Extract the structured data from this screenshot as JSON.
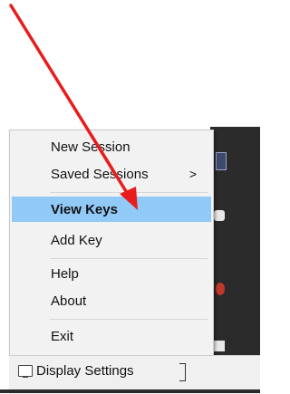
{
  "menu": {
    "items": [
      {
        "label": "New Session",
        "submenu": false,
        "highlighted": false
      },
      {
        "label": "Saved Sessions",
        "submenu": true,
        "highlighted": false
      },
      {
        "label": "View Keys",
        "submenu": false,
        "highlighted": true
      },
      {
        "label": "Add Key",
        "submenu": false,
        "highlighted": false
      },
      {
        "label": "Help",
        "submenu": false,
        "highlighted": false
      },
      {
        "label": "About",
        "submenu": false,
        "highlighted": false
      },
      {
        "label": "Exit",
        "submenu": false,
        "highlighted": false
      }
    ],
    "submenu_glyph": ">"
  },
  "taskbar": {
    "display_settings_label": "Display Settings"
  },
  "annotation": {
    "arrow_color": "#e81c1c",
    "highlight_color": "#91c9f7"
  }
}
